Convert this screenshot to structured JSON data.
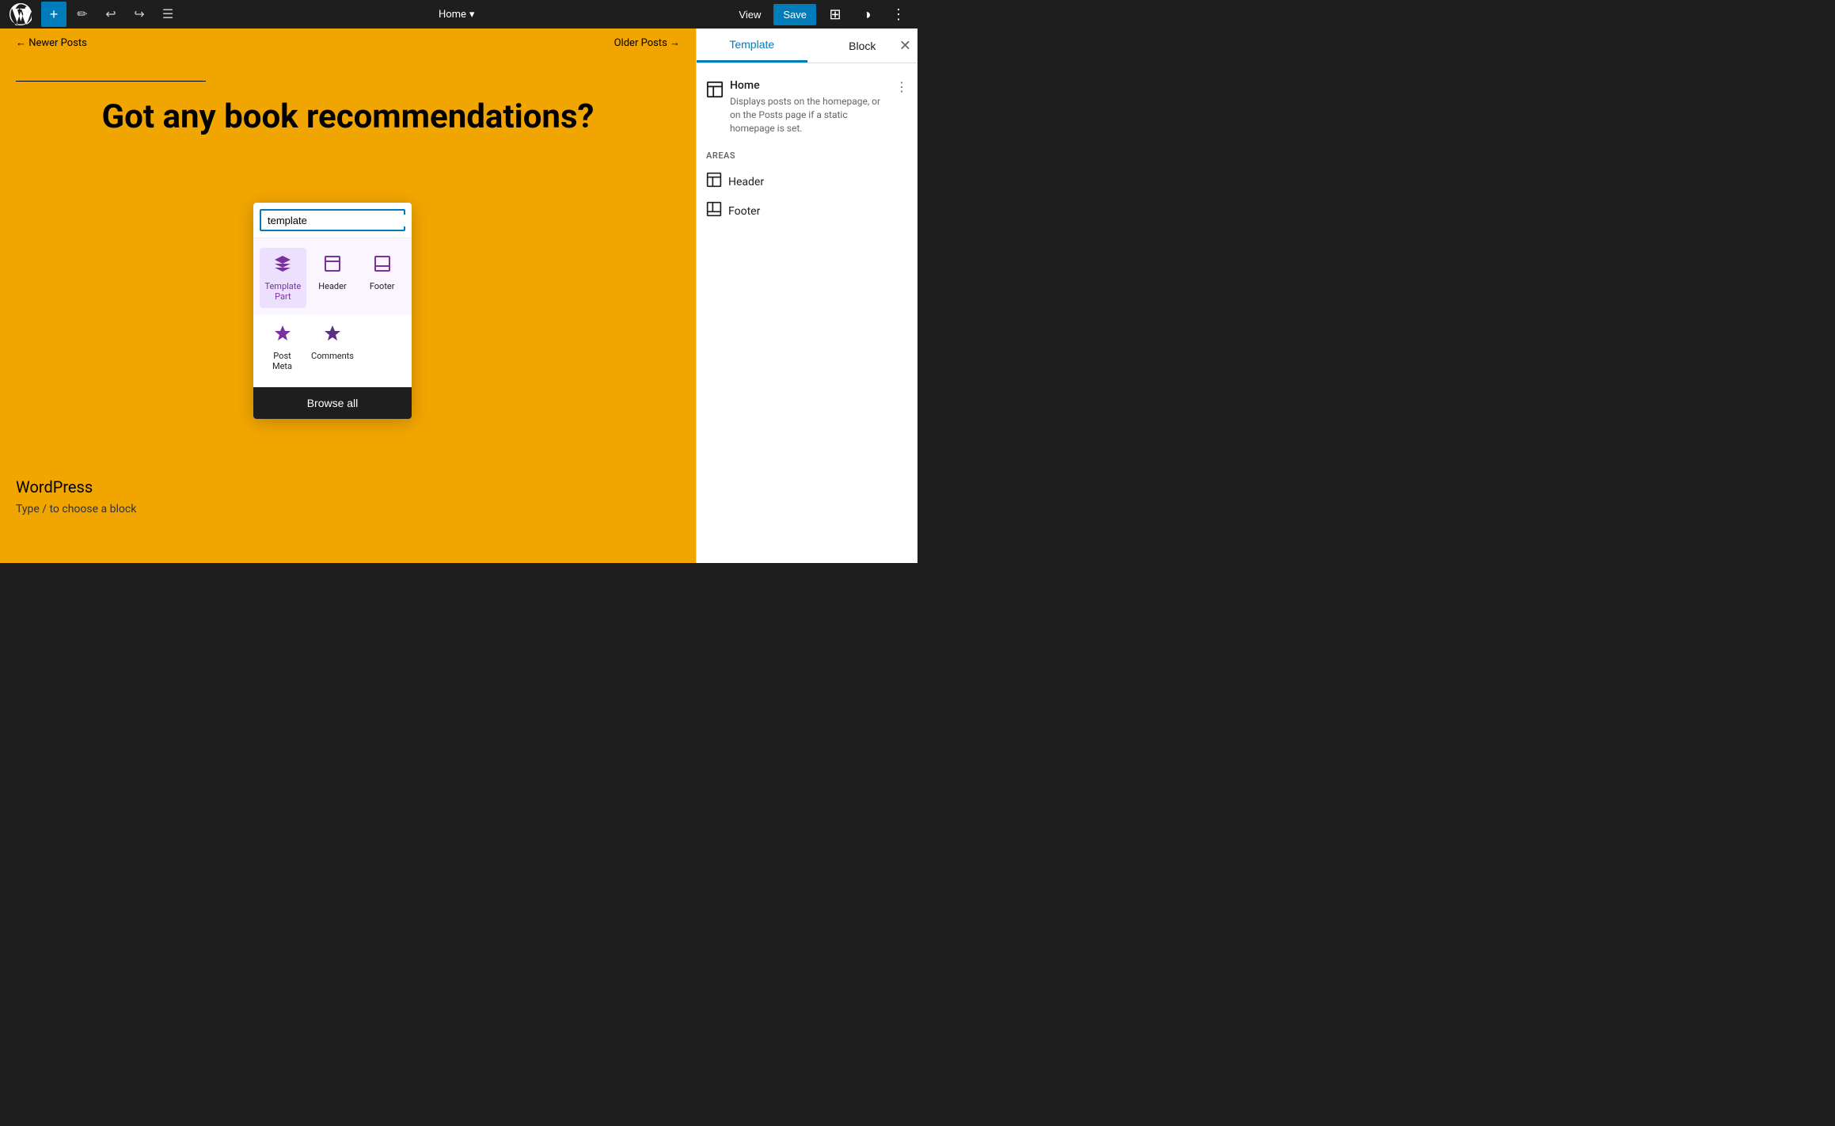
{
  "toolbar": {
    "title": "Home",
    "title_chevron": "▾",
    "view_label": "View",
    "save_label": "Save"
  },
  "canvas": {
    "nav": {
      "newer_posts": "← Newer Posts",
      "older_posts": "Older Posts →"
    },
    "heading": "Got any book recommendations?",
    "site_name": "WordPress",
    "block_hint": "Type / to choose a block"
  },
  "inserter": {
    "search_value": "template",
    "search_placeholder": "template",
    "items": [
      {
        "id": "template-part",
        "label": "Template Part",
        "active": true
      },
      {
        "id": "header",
        "label": "Header",
        "active": false
      },
      {
        "id": "footer",
        "label": "Footer",
        "active": false
      },
      {
        "id": "post-meta",
        "label": "Post Meta",
        "active": false
      },
      {
        "id": "comments",
        "label": "Comments",
        "active": false
      }
    ],
    "browse_all": "Browse all"
  },
  "sidebar": {
    "tab_template": "Template",
    "tab_block": "Block",
    "template_icon": "⊞",
    "template_name": "Home",
    "template_menu_aria": "More options",
    "template_description": "Displays posts on the homepage, or on the Posts page if a static homepage is set.",
    "areas_label": "AREAS",
    "areas": [
      {
        "id": "header",
        "name": "Header"
      },
      {
        "id": "footer",
        "name": "Footer"
      }
    ]
  }
}
